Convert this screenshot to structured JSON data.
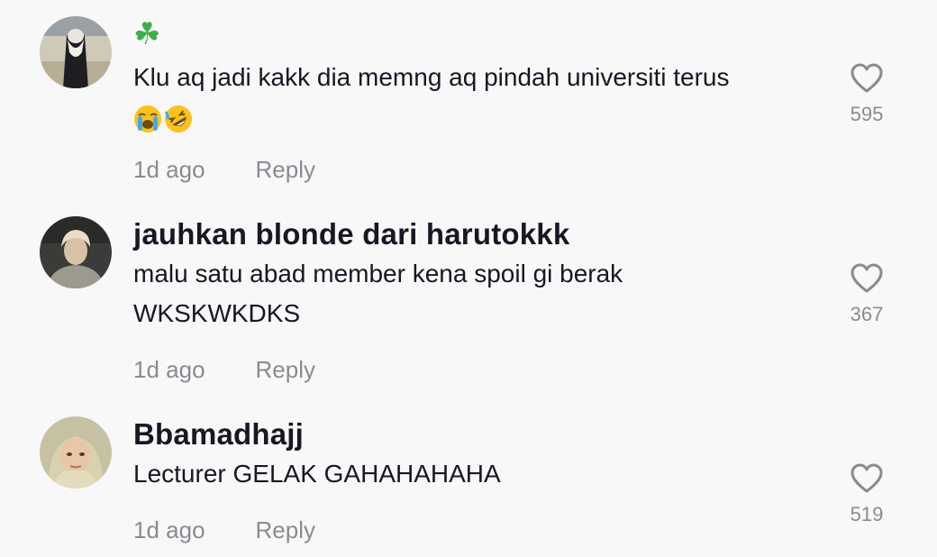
{
  "comments": [
    {
      "username": "",
      "username_icon": "four-leaf-clover-icon",
      "username_glyph": "☘",
      "text": "Klu aq jadi kakk dia memng aq pindah universiti terus",
      "emojis": [
        "loudly-crying-face-icon",
        "rolling-on-floor-laughing-icon"
      ],
      "time": "1d ago",
      "reply_label": "Reply",
      "likes": "595"
    },
    {
      "username": "jauhkan blonde dari harutokkk",
      "text": "malu satu abad member kena spoil gi berak WKSKWKDKS",
      "time": "1d ago",
      "reply_label": "Reply",
      "likes": "367"
    },
    {
      "username": "Bbamadhajj",
      "text": "Lecturer GELAK GAHAHAHAHA",
      "time": "1d ago",
      "reply_label": "Reply",
      "likes": "519"
    }
  ],
  "colors": {
    "background": "#f8f8f8",
    "primary_text": "#161823",
    "secondary_text": "#8a8b91",
    "like_icon": "#8a8b91"
  }
}
